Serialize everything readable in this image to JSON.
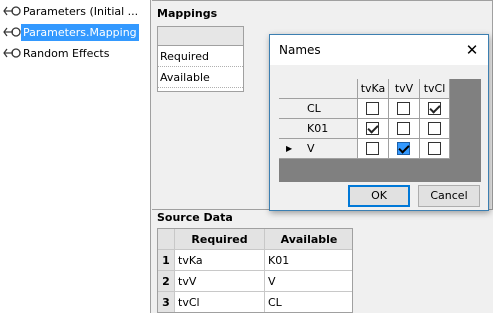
{
  "tree": {
    "items": [
      {
        "label": "Parameters (Initial ...",
        "icon": "parameter-node-icon",
        "selected": false
      },
      {
        "label": "Parameters.Mapping",
        "icon": "parameter-node-icon",
        "selected": true
      },
      {
        "label": "Random Effects",
        "icon": "parameter-node-icon",
        "selected": false
      }
    ]
  },
  "mappings": {
    "title": "Mappings",
    "rows": [
      "Required",
      "Available"
    ]
  },
  "source_data": {
    "title": "Source Data",
    "columns": [
      "Required",
      "Available"
    ],
    "rows": [
      {
        "num": "1",
        "required": "tvKa",
        "available": "K01"
      },
      {
        "num": "2",
        "required": "tvV",
        "available": "V"
      },
      {
        "num": "3",
        "required": "tvCl",
        "available": "CL"
      }
    ]
  },
  "dialog": {
    "title": "Names",
    "close_glyph": "✕",
    "columns": [
      "tvKa",
      "tvV",
      "tvCl"
    ],
    "rows": [
      {
        "name": "CL",
        "checks": [
          false,
          false,
          true
        ],
        "current": false
      },
      {
        "name": "K01",
        "checks": [
          true,
          false,
          false
        ],
        "current": false
      },
      {
        "name": "V",
        "checks": [
          false,
          true,
          false
        ],
        "current": true
      }
    ],
    "row_indicator": "▶",
    "ok_label": "OK",
    "cancel_label": "Cancel"
  },
  "colors": {
    "selection": "#3399ff",
    "dialog_border": "#3c7fb1",
    "default_button_border": "#0078d7"
  }
}
